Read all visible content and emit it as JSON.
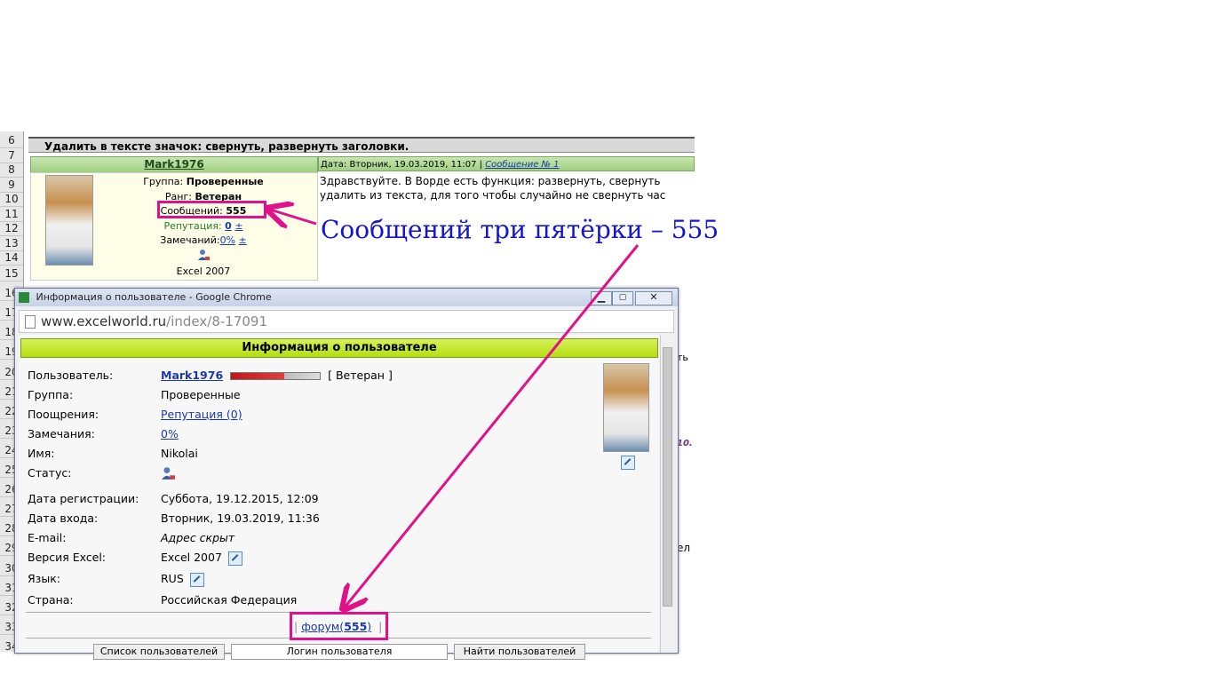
{
  "sheet": {
    "row_numbers": [
      "6",
      "7",
      "8",
      "9",
      "10",
      "11",
      "12",
      "13",
      "14",
      "15",
      "16",
      "17",
      "18",
      "19",
      "20",
      "21",
      "22",
      "23",
      "24",
      "25",
      "26",
      "27",
      "28",
      "29",
      "30",
      "31",
      "32",
      "33",
      "34"
    ],
    "thread_title": "Удалить в тексте значок: свернуть, развернуть заголовки.",
    "author": "Mark1976",
    "post_date": "Дата: Вторник, 19.03.2019, 11:07 |",
    "post_number": "Сообщение № 1",
    "group_label": "Группа:",
    "group_value": "Проверенные",
    "rank_label": "Ранг:",
    "rank_value": "Ветеран",
    "messages_label": "Сообщений:",
    "messages_value": "555",
    "reputation_label": "Репутация:",
    "reputation_value": "0",
    "reputation_pm": "±",
    "remarks_label": "Замечаний:",
    "remarks_value": "0%",
    "remarks_pm": "±",
    "excel_version": "Excel 2007",
    "post_line1": "Здравствуйте. В Ворде есть функция: развернуть, свернуть",
    "post_line2": "удалить из текста, для того чтобы случайно не свернуть час",
    "side_fragments": [
      "ть",
      "10.",
      "ел"
    ]
  },
  "callout_text": "Сообщений три пятёрки – 555",
  "window": {
    "title": "Информация о пользователе - Google Chrome",
    "url_host": "www.excelworld.ru",
    "url_path": "/index/8-17091",
    "header": "Информация о пользователе",
    "rows": [
      {
        "label": "Пользователь:",
        "value": "Mark1976"
      },
      {
        "label": "Группа:",
        "value": "Проверенные"
      },
      {
        "label": "Поощрения:",
        "value": "Репутация (0)"
      },
      {
        "label": "Замечания:",
        "value": "0%"
      },
      {
        "label": "Имя:",
        "value": "Nikolai"
      },
      {
        "label": "Статус:",
        "value": ""
      },
      {
        "label": "Дата регистрации:",
        "value": "Суббота, 19.12.2015, 12:09"
      },
      {
        "label": "Дата входа:",
        "value": "Вторник, 19.03.2019, 11:36"
      },
      {
        "label": "E-mail:",
        "value": "Адрес скрыт"
      },
      {
        "label": "Версия Excel:",
        "value": "Excel 2007"
      },
      {
        "label": "Язык:",
        "value": "RUS"
      },
      {
        "label": "Страна:",
        "value": "Российская Федерация"
      }
    ],
    "rank_badge": "[ Ветеран ]",
    "forum_link_prefix": "форум(",
    "forum_link_count": "555",
    "forum_link_suffix": ")",
    "pipe": "|",
    "buttons": [
      "Список пользователей",
      "Логин пользователя",
      "Найти пользователей"
    ]
  },
  "colors": {
    "accent_magenta": "#e0118a",
    "link_blue": "#1a3aa8",
    "callout_blue": "#1515d0",
    "green_header": "#b5dd10"
  }
}
